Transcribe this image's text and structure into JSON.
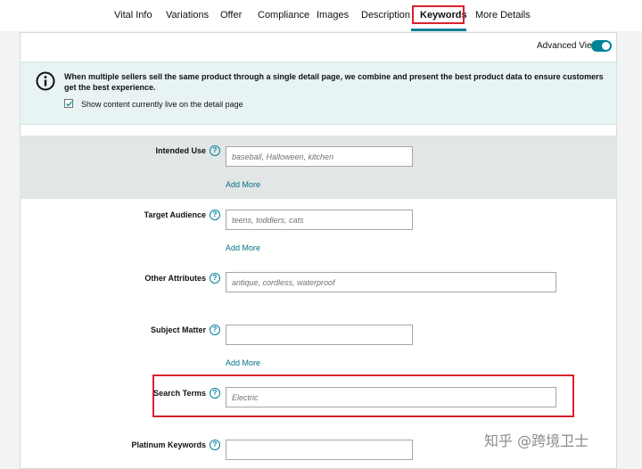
{
  "tabs": [
    {
      "label": "Vital Info",
      "active": false
    },
    {
      "label": "Variations",
      "active": false
    },
    {
      "label": "Offer",
      "active": false
    },
    {
      "label": "Compliance",
      "active": false
    },
    {
      "label": "Images",
      "active": false
    },
    {
      "label": "Description",
      "active": false
    },
    {
      "label": "Keywords",
      "active": true
    },
    {
      "label": "More Details",
      "active": false
    }
  ],
  "advanced_view": {
    "label": "Advanced View",
    "enabled": true
  },
  "info": {
    "icon": "info-circle-icon",
    "text": "When multiple sellers sell the same product through a single detail page, we combine and present the best product data to ensure customers get the best experience.",
    "checkbox_label": "Show content currently live on the detail page",
    "checkbox_checked": true
  },
  "fields": {
    "intended_use": {
      "label": "Intended Use",
      "placeholder": "baseball, Halloween, kitchen",
      "add_more": "Add More"
    },
    "target_audience": {
      "label": "Target Audience",
      "placeholder": "teens, toddlers, cats",
      "add_more": "Add More"
    },
    "other_attributes": {
      "label": "Other Attributes",
      "placeholder": "antique, cordless, waterproof"
    },
    "subject_matter": {
      "label": "Subject Matter",
      "placeholder": "",
      "add_more": "Add More"
    },
    "search_terms": {
      "label": "Search Terms",
      "placeholder": "Electric"
    },
    "platinum_keywords": {
      "label": "Platinum Keywords",
      "placeholder": ""
    }
  },
  "help_icon": "?",
  "colors": {
    "accent": "#008296",
    "highlight": "#d9212e",
    "link": "#007185",
    "info_bg": "#e8f3f3"
  },
  "watermark": "知乎 @跨境卫士"
}
